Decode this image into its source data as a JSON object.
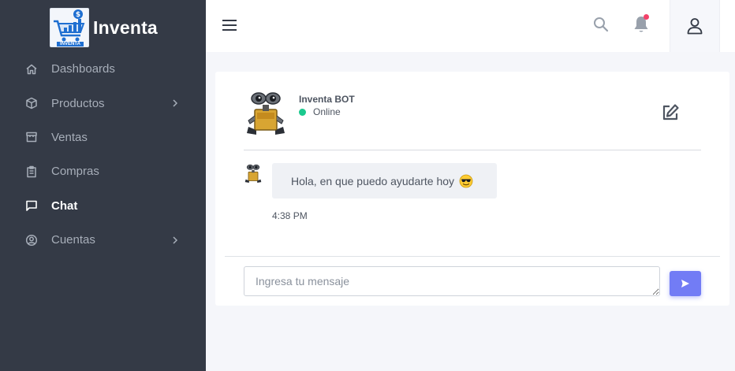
{
  "brand": {
    "name": "Inventa",
    "logo_text": "INVENTA"
  },
  "sidebar": {
    "items": [
      {
        "label": "Dashboards",
        "icon": "home-icon"
      },
      {
        "label": "Productos",
        "icon": "box-icon",
        "expandable": true
      },
      {
        "label": "Ventas",
        "icon": "store-icon"
      },
      {
        "label": "Compras",
        "icon": "clipboard-icon"
      },
      {
        "label": "Chat",
        "icon": "message-square-icon",
        "active": true
      },
      {
        "label": "Cuentas",
        "icon": "user-circle-icon",
        "expandable": true
      }
    ]
  },
  "topbar": {
    "menu_icon": "hamburger-menu-icon",
    "search_icon": "search-icon",
    "notification_icon": "bell-icon",
    "user_icon": "user-icon"
  },
  "chat": {
    "bot_name": "Inventa BOT",
    "status": "Online",
    "messages": [
      {
        "text": "Hola, en que puedo ayudarte hoy",
        "emoji": "sunglasses-face",
        "time": "4:38 PM"
      }
    ],
    "input_placeholder": "Ingresa tu mensaje",
    "send_icon": "send-icon"
  },
  "colors": {
    "sidebar_bg": "#343a46",
    "accent": "#727cf5",
    "online": "#1bc98e",
    "notification_dot": "#f3426a",
    "page_bg": "#f5f6fa"
  }
}
